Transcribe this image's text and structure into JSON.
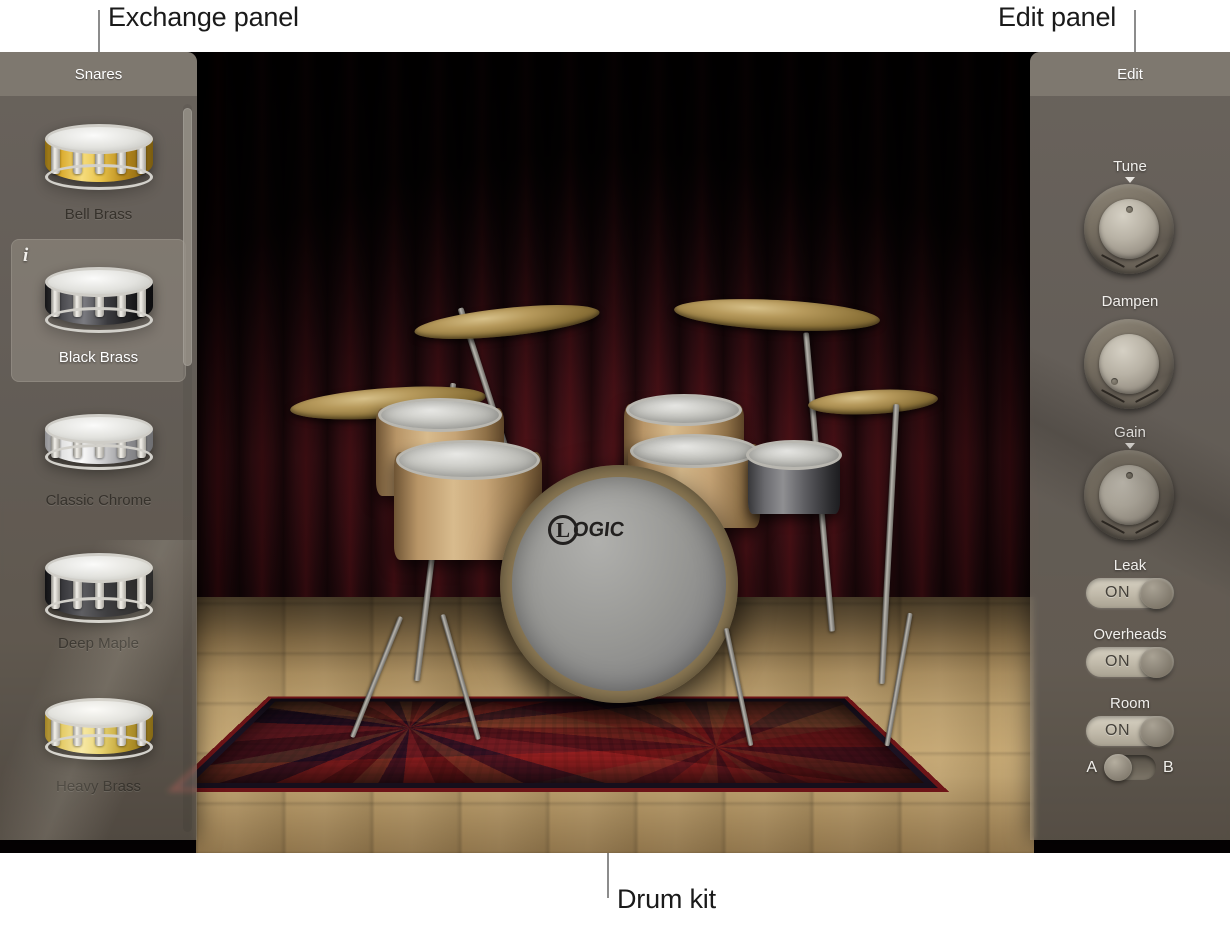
{
  "callouts": [
    {
      "id": "exchange",
      "label": "Exchange panel"
    },
    {
      "id": "edit",
      "label": "Edit panel"
    },
    {
      "id": "drumkit",
      "label": "Drum kit"
    }
  ],
  "exchange_panel": {
    "title": "Snares",
    "items": [
      {
        "label": "Bell Brass",
        "finish": "gold",
        "selected": false,
        "info_icon": ""
      },
      {
        "label": "Black Brass",
        "finish": "black",
        "selected": true,
        "info_icon": "i"
      },
      {
        "label": "Classic Chrome",
        "finish": "chrome",
        "selected": false,
        "info_icon": ""
      },
      {
        "label": "Deep Maple",
        "finish": "maple",
        "selected": false,
        "info_icon": ""
      },
      {
        "label": "Heavy Brass",
        "finish": "brass",
        "selected": false,
        "info_icon": ""
      }
    ]
  },
  "edit_panel": {
    "title": "Edit",
    "knobs": [
      {
        "label": "Tune",
        "rotation_deg": 0,
        "has_pointer_tick": true
      },
      {
        "label": "Dampen",
        "rotation_deg": 205,
        "has_pointer_tick": false
      },
      {
        "label": "Gain",
        "rotation_deg": 0,
        "has_pointer_tick": true
      }
    ],
    "toggles": [
      {
        "label": "Leak",
        "value": "ON",
        "state": "on"
      },
      {
        "label": "Overheads",
        "value": "ON",
        "state": "on"
      },
      {
        "label": "Room",
        "value": "ON",
        "state": "on"
      }
    ],
    "ab_switch": {
      "left_label": "A",
      "right_label": "B",
      "selected": "A"
    }
  },
  "drum_kit": {
    "bass_drum_logo": {
      "initial": "L",
      "rest": "OGIC"
    }
  },
  "colors": {
    "panel_bg": "#6e6760",
    "panel_header": "#807971",
    "title_text": "#ffffff",
    "item_label": "#36322c",
    "selected_item_bg": "#918a80",
    "curtain": "#3a1016",
    "floor": "#bda06d",
    "rug": "#6d1417",
    "callout_text": "#1a1a1a",
    "callout_line": "#8c8c8c"
  }
}
